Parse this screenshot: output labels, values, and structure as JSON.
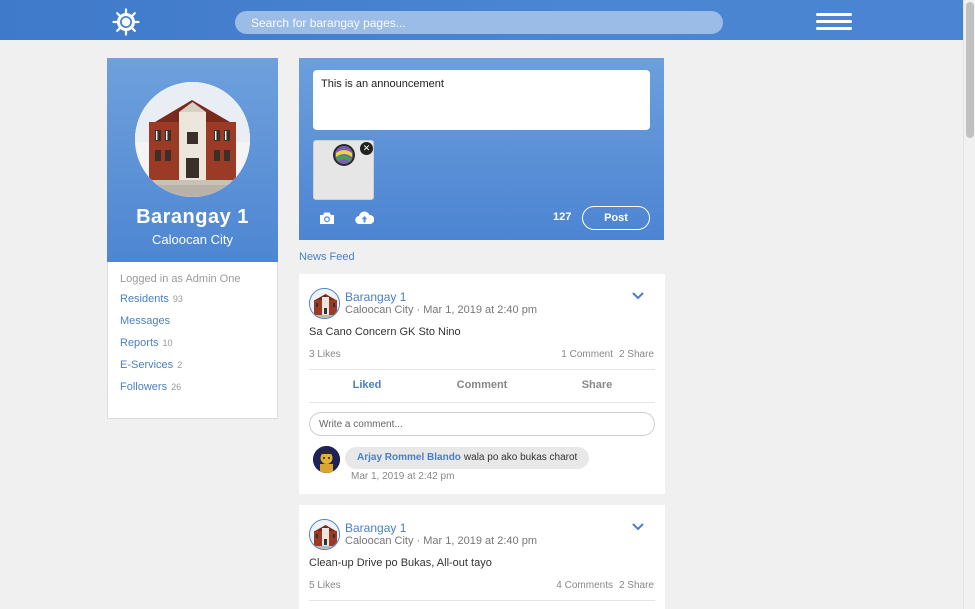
{
  "header": {
    "logo_icon": "barangay-seal-icon",
    "search_placeholder": "Search for barangay pages...",
    "menu_icon": "hamburger-icon",
    "bar_color": "#4a84d2"
  },
  "profile": {
    "name": "Barangay 1",
    "city": "Caloocan City",
    "photo_icon": "barangay-hall-photo"
  },
  "sidebar": {
    "logged_in": "Logged in as Admin One",
    "items": [
      {
        "label": "Residents",
        "count": "93"
      },
      {
        "label": "Messages",
        "count": ""
      },
      {
        "label": "Reports",
        "count": "10"
      },
      {
        "label": "E-Services",
        "count": "2"
      },
      {
        "label": "Followers",
        "count": "26"
      }
    ]
  },
  "composer": {
    "text": "This is an announcement",
    "char_count": "127",
    "post_label": "Post",
    "camera_icon": "camera-icon",
    "upload_icon": "cloud-upload-icon",
    "remove_icon": "close-icon"
  },
  "feed": {
    "label": "News Feed",
    "posts": [
      {
        "author": "Barangay 1",
        "city": "Caloocan City",
        "date": "Mar 1, 2019 at 2:40 pm",
        "text": "Sa Cano Concern GK Sto Nino",
        "likes": "3 Likes",
        "comments": "1 Comment",
        "shares": "2 Share",
        "actions": {
          "like": "Liked",
          "comment": "Comment",
          "share": "Share"
        },
        "comment_placeholder": "Write a comment...",
        "comment_list": [
          {
            "name": "Arjay Rommel Blando",
            "text": "wala po ako bukas charot",
            "time": "Mar 1, 2019 at 2:42 pm"
          }
        ]
      },
      {
        "author": "Barangay 1",
        "city": "Caloocan City",
        "date": "Mar 1, 2019 at 2:40 pm",
        "text": "Clean-up Drive po Bukas, All-out tayo",
        "likes": "5 Likes",
        "comments": "4 Comments",
        "shares": "2 Share"
      }
    ]
  },
  "colors": {
    "accent": "#4a7fc6",
    "background": "#f0f0f0"
  }
}
